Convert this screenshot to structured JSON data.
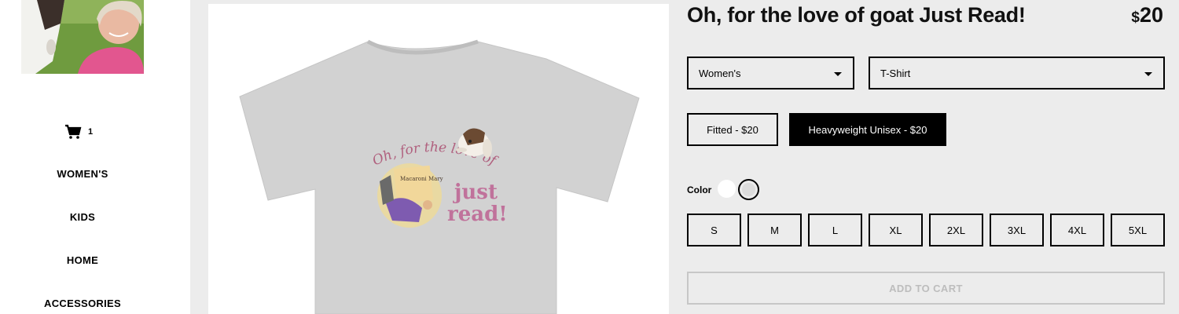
{
  "sidebar": {
    "cart_count": "1",
    "nav": [
      "WOMEN'S",
      "KIDS",
      "HOME",
      "ACCESSORIES"
    ]
  },
  "product": {
    "title": "Oh, for the love of goat Just Read!",
    "price_currency": "$",
    "price_value": "20",
    "design_line1": "Oh, for the love of goat",
    "design_line2": "just",
    "design_line3": "read!",
    "book_title": "Macaroni Mary"
  },
  "options": {
    "category": "Women's",
    "type": "T-Shirt",
    "styles": [
      "Fitted - $20",
      "Heavyweight Unisex - $20"
    ],
    "selected_style_index": 1,
    "color_label": "Color",
    "colors": [
      "#ffffff",
      "#dcdcdc"
    ],
    "sizes": [
      "S",
      "M",
      "L",
      "XL",
      "2XL",
      "3XL",
      "4XL",
      "5XL"
    ],
    "add_to_cart": "ADD TO CART"
  },
  "icons": {
    "cart": "cart-icon",
    "dropdown": "caret-down-icon"
  }
}
